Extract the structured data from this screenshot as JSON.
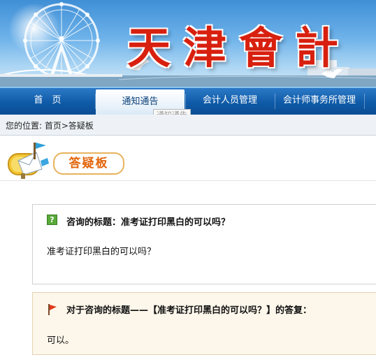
{
  "banner": {
    "logo_text": "天津會計",
    "colors": {
      "sky": "#6fb3ea",
      "logo_red": "#d8200f"
    }
  },
  "nav": {
    "items": [
      {
        "label": "首　页",
        "active": false
      },
      {
        "label": "通知通告",
        "active": true
      },
      {
        "label": "会计人员管理",
        "active": false
      },
      {
        "label": "会计师事务所管理",
        "active": false
      }
    ],
    "tooltip": "通知通告",
    "colors": {
      "bar": "#0f5ba8",
      "active_text": "#0b3f7a"
    }
  },
  "breadcrumb": {
    "text": "您的位置: 首页>答疑板"
  },
  "section": {
    "title": "答疑板",
    "icon": "mailbox-icon",
    "accent": "#e2650b"
  },
  "question": {
    "icon": "question-icon",
    "title_label": "咨询的标题：准考证打印黑白的可以吗？",
    "body": "准考证打印黑白的可以吗？"
  },
  "answer": {
    "icon": "red-flag-icon",
    "title": "对于咨询的标题——【准考证打印黑白的可以吗？】的答复：",
    "body": "可以。"
  }
}
